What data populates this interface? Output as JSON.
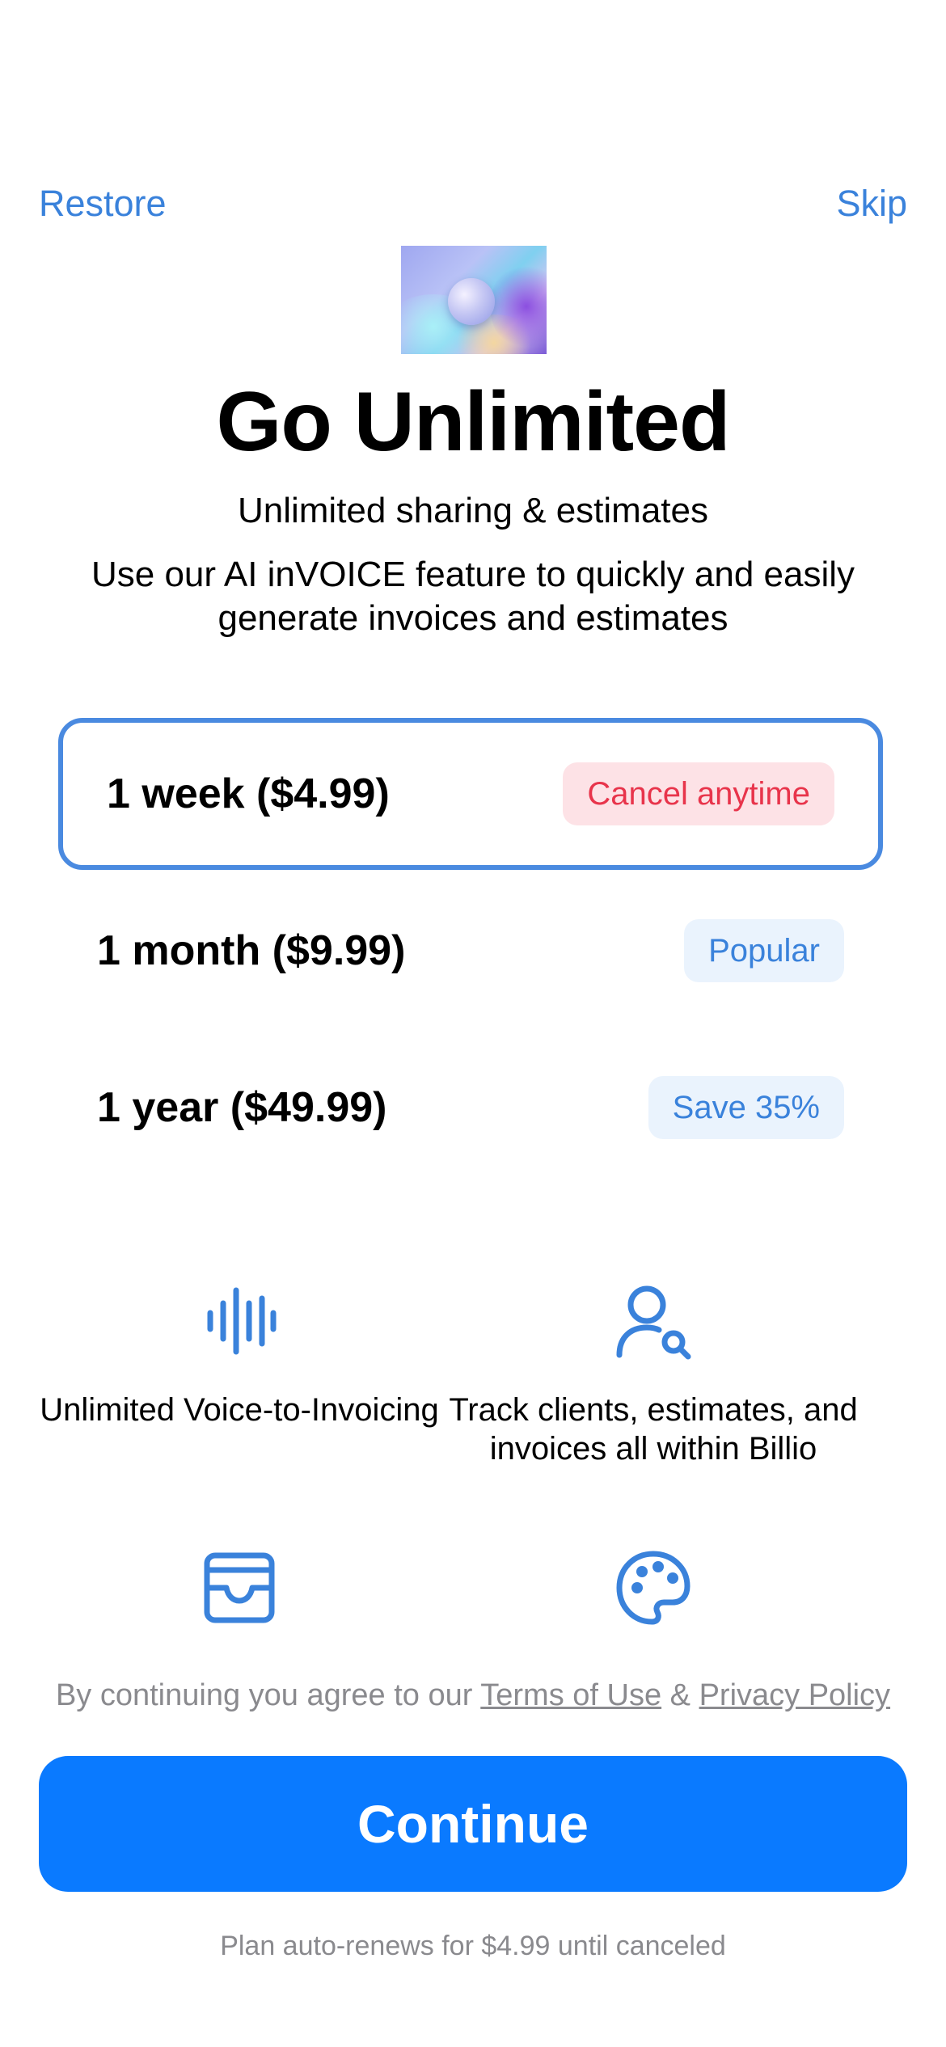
{
  "header": {
    "restore_label": "Restore",
    "skip_label": "Skip"
  },
  "hero": {
    "title": "Go Unlimited",
    "subtitle": "Unlimited sharing & estimates",
    "description": "Use our AI inVOICE feature to quickly and easily generate invoices and estimates"
  },
  "plans": [
    {
      "label": "1 week ($4.99)",
      "badge": "Cancel anytime",
      "selected": true
    },
    {
      "label": "1 month ($9.99)",
      "badge": "Popular",
      "selected": false
    },
    {
      "label": "1 year ($49.99)",
      "badge": "Save 35%",
      "selected": false
    }
  ],
  "features": [
    {
      "icon": "waveform-icon",
      "label": "Unlimited Voice-to-Invoicing"
    },
    {
      "icon": "person-search-icon",
      "label": "Track clients, estimates, and invoices all within Billio"
    },
    {
      "icon": "wallet-icon",
      "label": ""
    },
    {
      "icon": "palette-icon",
      "label": ""
    }
  ],
  "legal": {
    "prefix": "By continuing you agree to our ",
    "terms_label": "Terms of Use",
    "separator": " & ",
    "privacy_label": "Privacy Policy"
  },
  "cta": {
    "continue_label": "Continue"
  },
  "footer": {
    "renew_text": "Plan auto-renews for $4.99 until canceled"
  },
  "colors": {
    "accent": "#3a82db",
    "button": "#0a7aff",
    "badge_red_text": "#e8344b",
    "badge_red_bg": "#fde2e6",
    "badge_blue_bg": "#eaf3fd",
    "muted_text": "#8a8a8e"
  }
}
